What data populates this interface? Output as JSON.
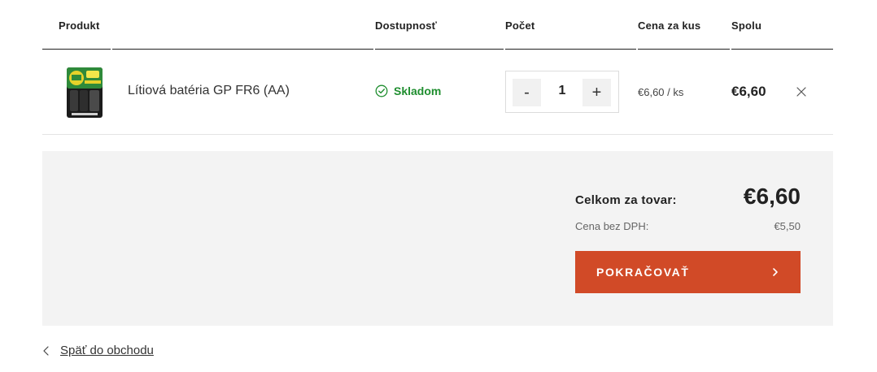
{
  "table": {
    "headers": {
      "product": "Produkt",
      "availability": "Dostupnosť",
      "quantity": "Počet",
      "unit_price": "Cena za kus",
      "total": "Spolu"
    }
  },
  "items": [
    {
      "name": "Lítiová batéria GP FR6 (AA)",
      "availability": "Skladom",
      "quantity": "1",
      "minus_label": "-",
      "plus_label": "+",
      "unit_price": "€6,60 / ks",
      "total": "€6,60",
      "image_icon": "battery-product-image",
      "remove_icon": "close-icon"
    }
  ],
  "summary": {
    "goods_total_label": "Celkom za tovar:",
    "goods_total_value": "€6,60",
    "vat_free_label": "Cena bez DPH:",
    "vat_free_value": "€5,50",
    "continue_label": "POKRAČOVAŤ"
  },
  "back_link": {
    "label": "Späť do obchodu"
  },
  "colors": {
    "accent": "#d14a27",
    "available": "#1f8e2f",
    "summary_bg": "#f3f3f3",
    "divider": "#1f1f1f"
  }
}
